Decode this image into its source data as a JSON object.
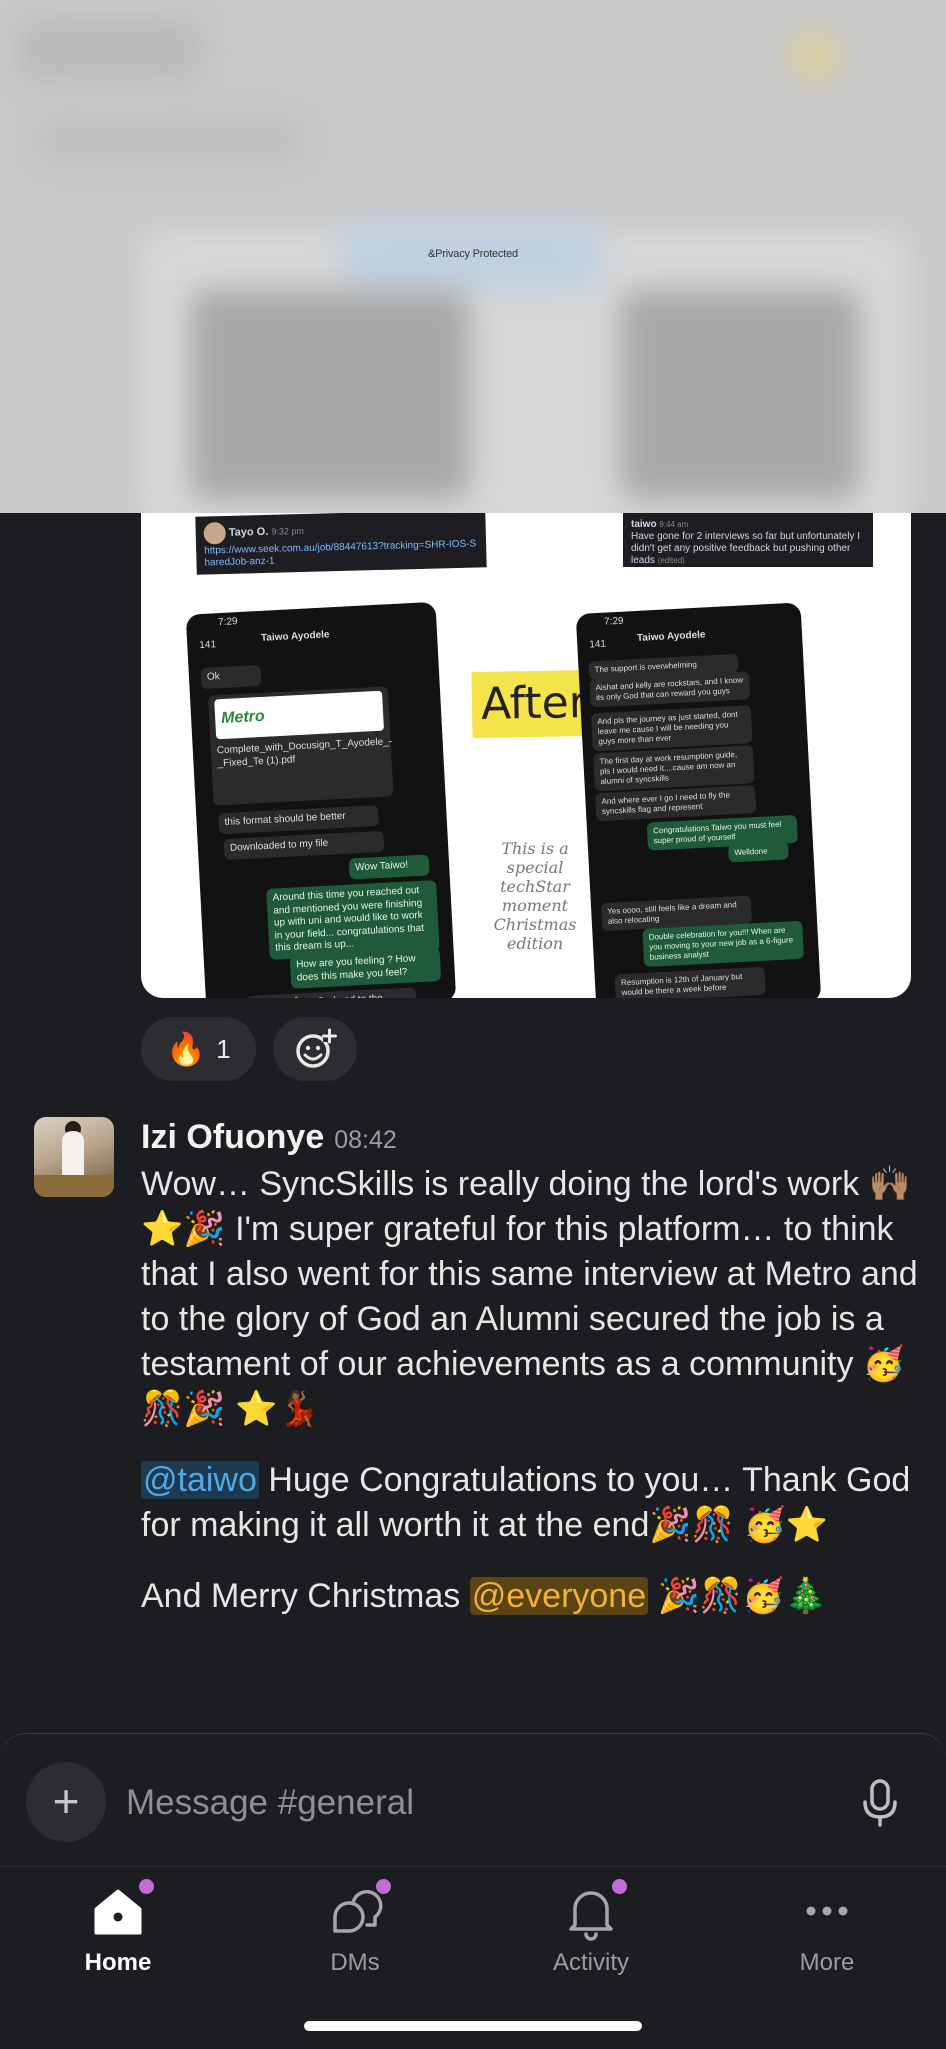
{
  "privacy_banner": "&Privacy Protected",
  "shared_image": {
    "snippet_left": {
      "name": "Tayo O.",
      "time": "9:32 pm",
      "link": "https://www.seek.com.au/job/88447613?tracking=SHR-IOS-SharedJob-anz-1"
    },
    "snippet_right": {
      "name": "taiwo",
      "time": "9:44 am",
      "text": "Have gone for 2 interviews so far but unfortunately I didn't get any positive feedback but pushing other leads",
      "edited": "(edited)"
    },
    "after_label": "After",
    "special_note": "This is a special techStar moment Christmas edition",
    "left_phone": {
      "clock": "7:29",
      "back_count": "141",
      "contact": "Taiwo Ayodele",
      "messages": [
        "Ok",
        "Complete_with_Docusign_T_Ayodele_-_Fixed_Te (1).pdf",
        "this format should be better",
        "Downloaded to my file",
        "Wow Taiwo!",
        "Around this time you reached out and mentioned you were finishing up with uni and would like to work in your field... congratulations that this dream is up...",
        "How are you feeling ? How does this make you feel?",
        "Grateful 🙏 to God and to the entire"
      ],
      "pdf_brand": "Metro"
    },
    "right_phone": {
      "clock": "7:29",
      "back_count": "141",
      "contact": "Taiwo Ayodele",
      "messages": [
        "The support is overwhelming",
        "Aishat and kelly are rockstars, and I know its only God that can reward you guys",
        "And pls the journey as just started, dont leave me cause I will be needing you guys more than ever",
        "The first day at work resumption guide, pls I would need it....cause am now an alumni of syncskills",
        "And where ever I go I need to fly the syncskills flag and represent",
        "Congratulations Taiwo you must feel super proud of yourself",
        "Welldone",
        "Yes oooo, still feels like a dream and also relocating",
        "Double celebration for you!!! When are you moving to your new job as a 6-figure business analyst",
        "Resumption is 12th of January but would be there a week before"
      ]
    }
  },
  "reactions": {
    "fire": {
      "emoji": "🔥",
      "count": "1"
    },
    "add_reaction_icon": "add-emoji-icon"
  },
  "message": {
    "sender": "Izi Ofuonye",
    "time": "08:42",
    "paragraph1": "Wow… SyncSkills is really doing the lord's work 🙌🏽⭐🎉 I'm super grateful for this platform… to think that I also went for this same interview at Metro and to the glory of God an Alumni secured the job is a testament of our achievements as a community 🥳🎊🎉 ⭐💃🏾",
    "mention_user": "@taiwo",
    "paragraph2": " Huge Congratulations to you… Thank God for making it all worth it at the end🎉🎊 🥳⭐",
    "paragraph3_prefix": "And Merry Christmas ",
    "mention_everyone": "@everyone",
    "paragraph3_suffix": " 🎉🎊🥳🎄"
  },
  "composer": {
    "placeholder": "Message #general",
    "plus_icon": "plus-icon",
    "mic_icon": "microphone-icon"
  },
  "nav": {
    "home": "Home",
    "dms": "DMs",
    "activity": "Activity",
    "more": "More"
  },
  "colors": {
    "background": "#1b1d21",
    "mention": "#4fa8e8",
    "mention_everyone": "#f1b233",
    "notification_dot": "#c36bd9"
  }
}
